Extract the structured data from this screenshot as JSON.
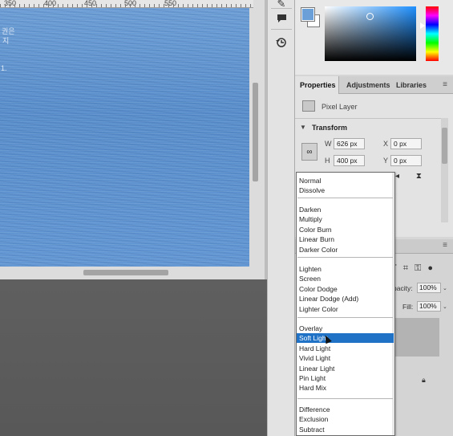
{
  "ruler": {
    "labels": [
      "350",
      "400",
      "450",
      "500",
      "550"
    ]
  },
  "canvas": {
    "overlay_text": [
      "권은",
      "지",
      "1."
    ]
  },
  "color": {
    "foreground": "#6b9fd7",
    "background": "#ffffff"
  },
  "tabs": [
    {
      "label": "Properties",
      "active": true
    },
    {
      "label": "Adjustments",
      "active": false
    },
    {
      "label": "Libraries",
      "active": false
    }
  ],
  "properties": {
    "layer_type": "Pixel Layer",
    "section_title": "Transform",
    "w_label": "W",
    "w_value": "626 px",
    "h_label": "H",
    "h_value": "400 px",
    "x_label": "X",
    "x_value": "0 px",
    "y_label": "Y",
    "y_value": "0 px"
  },
  "layers": {
    "opacity_label": "pacity:",
    "opacity_value": "100%",
    "fill_label": "Fill:",
    "fill_value": "100%"
  },
  "blend_modes": {
    "selected": "Soft Light",
    "groups": [
      [
        "Normal",
        "Dissolve"
      ],
      [
        "Darken",
        "Multiply",
        "Color Burn",
        "Linear Burn",
        "Darker Color"
      ],
      [
        "Lighten",
        "Screen",
        "Color Dodge",
        "Linear Dodge (Add)",
        "Lighter Color"
      ],
      [
        "Overlay",
        "Soft Light",
        "Hard Light",
        "Vivid Light",
        "Linear Light",
        "Pin Light",
        "Hard Mix"
      ],
      [
        "Difference",
        "Exclusion",
        "Subtract"
      ]
    ]
  }
}
